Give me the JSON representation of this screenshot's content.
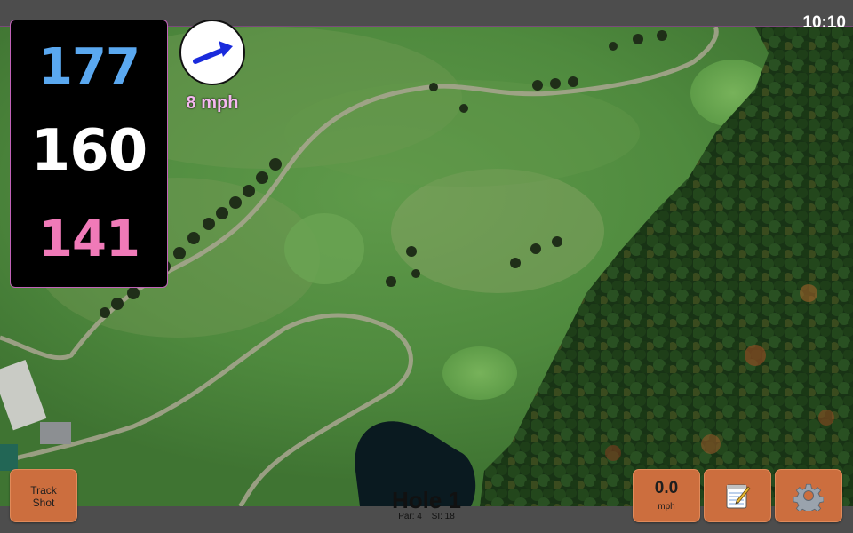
{
  "status_bar": {
    "time": "10:10"
  },
  "distances": {
    "back": "177",
    "center": "160",
    "front": "141"
  },
  "wind": {
    "speed_label": "8 mph",
    "direction_icon": "arrow-up-right-icon"
  },
  "hole": {
    "title": "Hole 1",
    "par_label": "Par: 4",
    "si_label": "SI: 18"
  },
  "buttons": {
    "track_shot": [
      "Track",
      "Shot"
    ],
    "wind_value": "0.0",
    "wind_unit": "mph",
    "notes_icon": "notepad-icon",
    "settings_icon": "gear-icon"
  },
  "colors": {
    "back_distance": "#5aa8f0",
    "center_distance": "#ffffff",
    "front_distance": "#f07ab8",
    "button": "#cc6e3e",
    "bar": "#4d4d4d"
  }
}
